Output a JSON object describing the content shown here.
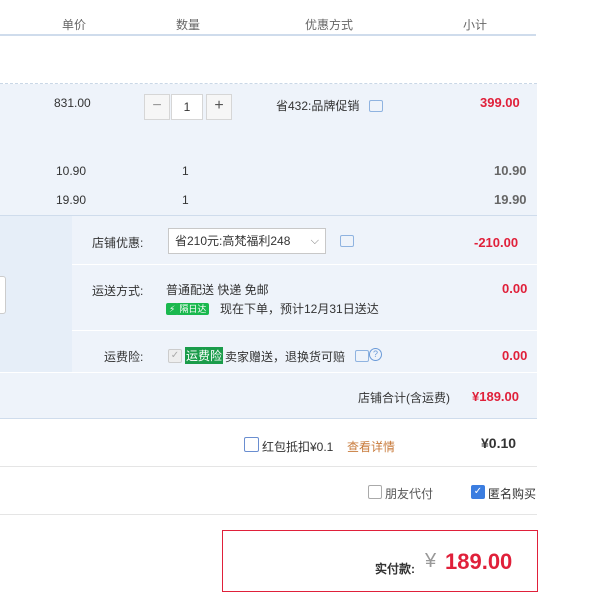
{
  "header": {
    "unit_price": "单价",
    "quantity": "数量",
    "discount_method": "优惠方式",
    "subtotal": "小计"
  },
  "item_main": {
    "unit_price": "831.00",
    "quantity": "1",
    "minus": "−",
    "plus": "+",
    "discount": "省432:品牌促销",
    "subtotal": "399.00"
  },
  "item_2": {
    "unit_price": "10.90",
    "quantity": "1",
    "subtotal": "10.90"
  },
  "item_3": {
    "unit_price": "19.90",
    "quantity": "1",
    "subtotal": "19.90"
  },
  "shop": {
    "discount_label": "店铺优惠:",
    "discount_value": "省210元:高梵福利248",
    "discount_amount": "-210.00",
    "shipping_label": "运送方式:",
    "shipping_value": "普通配送 快递 免邮",
    "shipping_badge": "隔日达",
    "shipping_note": "现在下单，预计12月31日送达",
    "shipping_amount": "0.00",
    "insurance_label": "运费险:",
    "insurance_tag": "运费险",
    "insurance_text": "卖家赠送，退换货可赔",
    "insurance_amount": "0.00",
    "total_label": "店铺合计(含运费)",
    "total_value": "¥189.00"
  },
  "redpacket": {
    "label": "红包抵扣¥0.1",
    "link": "查看详情",
    "amount": "¥0.10"
  },
  "options": {
    "friend_pay": "朋友代付",
    "anonymous": "匿名购买",
    "anonymous_checked": true,
    "friend_pay_checked": false
  },
  "payment": {
    "label": "实付款:",
    "currency": "¥",
    "amount": "189.00"
  },
  "colors": {
    "accent_red": "#e0203a",
    "link_orange": "#c87b3c",
    "checkbox_blue": "#3b7de0"
  }
}
